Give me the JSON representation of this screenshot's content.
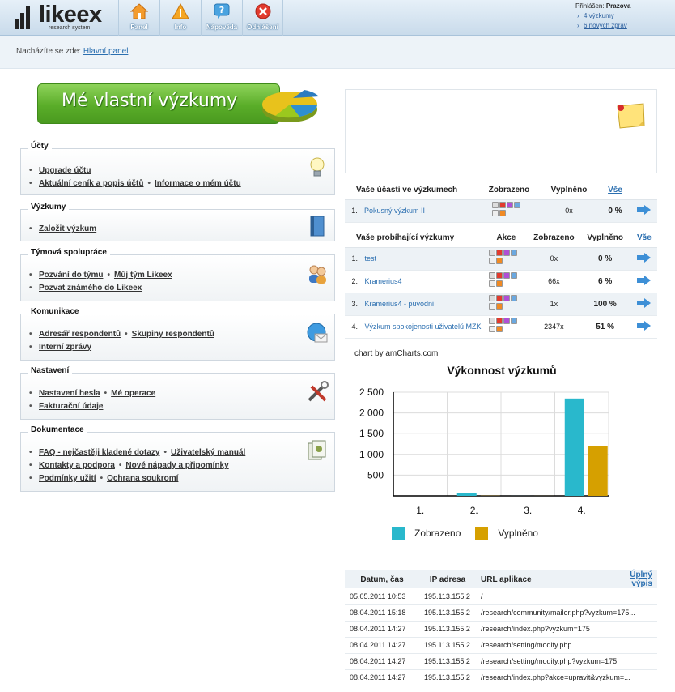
{
  "app": {
    "logo_text": "likeex",
    "logo_subtitle": "research system"
  },
  "nav": [
    {
      "label": "Panel",
      "icon": "home-icon"
    },
    {
      "label": "Info",
      "icon": "warning-icon"
    },
    {
      "label": "Nápověda",
      "icon": "help-icon"
    },
    {
      "label": "Odhlášení",
      "icon": "logout-icon"
    }
  ],
  "user": {
    "prefix": "Přihlášen:",
    "name": "Prazova",
    "links": [
      "4 výzkumy",
      "6 nových zpráv"
    ]
  },
  "breadcrumb": {
    "prefix": "Nacházíte se zde:",
    "link": "Hlavní panel"
  },
  "banner": {
    "text": "Mé vlastní výzkumy"
  },
  "sections": [
    {
      "title": "Účty",
      "icon": "lightbulb-icon",
      "rows": [
        [
          "Upgrade účtu"
        ],
        [
          "Aktuální ceník a popis účtů",
          "Informace o mém účtu"
        ]
      ]
    },
    {
      "title": "Výzkumy",
      "icon": "book-icon",
      "rows": [
        [
          "Založit výzkum"
        ]
      ]
    },
    {
      "title": "Týmová spolupráce",
      "icon": "users-icon",
      "rows": [
        [
          "Pozvání do týmu",
          "Můj tým Likeex"
        ],
        [
          "Pozvat známého do Likeex"
        ]
      ]
    },
    {
      "title": "Komunikace",
      "icon": "email-globe-icon",
      "rows": [
        [
          "Adresář respondentů",
          "Skupiny respondentů"
        ],
        [
          "Interní zprávy"
        ]
      ]
    },
    {
      "title": "Nastavení",
      "icon": "tools-icon",
      "rows": [
        [
          "Nastavení hesla",
          "Mé operace"
        ],
        [
          "Fakturační údaje"
        ]
      ]
    },
    {
      "title": "Dokumentace",
      "icon": "documents-icon",
      "rows": [
        [
          "FAQ - nejčastěji kladené dotazy",
          "Uživatelský manuál"
        ],
        [
          "Kontakty a podpora",
          "Nové nápady a připomínky"
        ],
        [
          "Podmínky užití",
          "Ochrana soukromí"
        ]
      ]
    }
  ],
  "participation": {
    "headers": [
      "Vaše účasti ve výzkumech",
      "Zobrazeno",
      "Vyplněno",
      "Vše"
    ],
    "rows": [
      {
        "num": "1.",
        "name": "Pokusný výzkum II",
        "shown": "0x",
        "filled": "0 %"
      }
    ]
  },
  "running": {
    "headers": [
      "Vaše probíhající výzkumy",
      "Akce",
      "Zobrazeno",
      "Vyplněno",
      "Vše"
    ],
    "rows": [
      {
        "num": "1.",
        "name": "test",
        "shown": "0x",
        "filled": "0 %"
      },
      {
        "num": "2.",
        "name": "Kramerius4",
        "shown": "66x",
        "filled": "6 %"
      },
      {
        "num": "3.",
        "name": "Kramerius4 - puvodni",
        "shown": "1x",
        "filled": "100 %"
      },
      {
        "num": "4.",
        "name": "Výzkum spokojenosti uživatelů MZK",
        "shown": "2347x",
        "filled": "51 %"
      }
    ]
  },
  "chart_credit": "chart by amCharts.com",
  "chart_data": {
    "type": "bar",
    "title": "Výkonnost výzkumů",
    "categories": [
      "1.",
      "2.",
      "3.",
      "4."
    ],
    "series": [
      {
        "name": "Zobrazeno",
        "values": [
          0,
          66,
          1,
          2347
        ],
        "color": "#29b8cc"
      },
      {
        "name": "Vyplněno",
        "values": [
          0,
          4,
          1,
          1197
        ],
        "color": "#d6a000"
      }
    ],
    "y_ticks": [
      "500",
      "1 000",
      "1 500",
      "2 000",
      "2 500"
    ],
    "ylim": [
      0,
      2500
    ],
    "grid": true,
    "legend": "bottom"
  },
  "log": {
    "headers": [
      "Datum, čas",
      "IP adresa",
      "URL aplikace",
      "Úplný výpis"
    ],
    "rows": [
      {
        "date": "05.05.2011 10:53",
        "ip": "195.113.155.2",
        "url": "/"
      },
      {
        "date": "08.04.2011 15:18",
        "ip": "195.113.155.2",
        "url": "/research/community/mailer.php?vyzkum=175..."
      },
      {
        "date": "08.04.2011 14:27",
        "ip": "195.113.155.2",
        "url": "/research/index.php?vyzkum=175"
      },
      {
        "date": "08.04.2011 14:27",
        "ip": "195.113.155.2",
        "url": "/research/setting/modify.php"
      },
      {
        "date": "08.04.2011 14:27",
        "ip": "195.113.155.2",
        "url": "/research/setting/modify.php?vyzkum=175"
      },
      {
        "date": "08.04.2011 14:27",
        "ip": "195.113.155.2",
        "url": "/research/index.php?akce=upravit&vyzkum=..."
      }
    ]
  }
}
